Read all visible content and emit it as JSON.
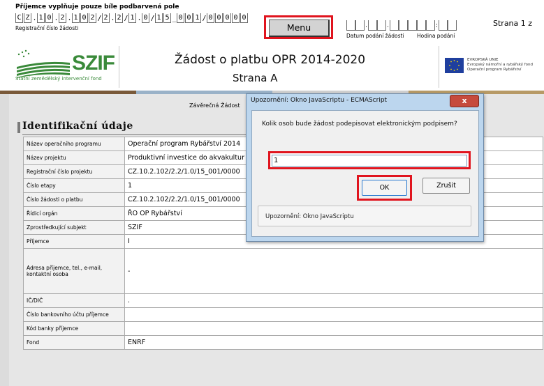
{
  "header": {
    "note": "Příjemce vyplňuje pouze bíle podbarvená pole",
    "registration_cells": [
      "C",
      "Z",
      ".",
      "1",
      "0",
      ".",
      "2",
      ".",
      "1",
      "0",
      "2",
      "/",
      "2",
      ".",
      "2",
      "/",
      "1",
      ".",
      "0",
      "/",
      "1",
      "5",
      "_",
      "0",
      "0",
      "1",
      "/",
      "0",
      "0",
      "0",
      "0",
      "0"
    ],
    "registration_label": "Registrační číslo žádosti",
    "menu_label": "Menu",
    "date_label": "Datum podání žádosti",
    "hour_label": "Hodina podání",
    "page_indicator": "Strana 1 z"
  },
  "titleband": {
    "logo_text": "SZIF",
    "logo_subtitle": "Státní zemědělský intervenční fond",
    "title": "Žádost o platbu OPR 2014-2020",
    "subtitle": "Strana A",
    "eu_lines": [
      "EVROPSKÁ UNIE",
      "Evropský námořní a rybářský fond",
      "Operační program Rybářství"
    ]
  },
  "colors": {
    "accent_red": "#e0141e",
    "bar": [
      "#7a5a3a",
      "#9ab2c8",
      "#cfcfcf",
      "#b79a66"
    ]
  },
  "main": {
    "final_label": "Závěrečná Žádost",
    "section_title": "Identifikační údaje",
    "rows": [
      {
        "label": "Název operačního programu",
        "value": "Operační program Rybářství 2014"
      },
      {
        "label": "Název projektu",
        "value": "Produktivní investice do akvakultur"
      },
      {
        "label": "Registrační číslo projektu",
        "value": "CZ.10.2.102/2.2/1.0/15_001/0000"
      },
      {
        "label": "Číslo etapy",
        "value": "1"
      },
      {
        "label": "Číslo žádosti o platbu",
        "value": "CZ.10.2.102/2.2/1.0/15_001/0000"
      },
      {
        "label": "Řídicí orgán",
        "value": "ŘO OP Rybářství"
      },
      {
        "label": "Zprostředkující subjekt",
        "value": "SZIF"
      },
      {
        "label": "Příjemce",
        "value": "I"
      },
      {
        "label": "Adresa příjemce, tel., e-mail, kontaktní osoba",
        "value": "-"
      },
      {
        "label": "IČ/DIČ",
        "value": "."
      },
      {
        "label": "Číslo bankovního účtu příjemce",
        "value": ""
      },
      {
        "label": "Kód banky příjemce",
        "value": ""
      },
      {
        "label": "Fond",
        "value": "ENRF"
      }
    ]
  },
  "dialog": {
    "title": "Upozornění: Okno JavaScriptu - ECMAScript",
    "close_label": "x",
    "question": "Kolik osob bude žádost podepisovat elektronickým podpisem?",
    "input_value": "1",
    "ok_label": "OK",
    "cancel_label": "Zrušit",
    "status": "Upozornění: Okno JavaScriptu"
  }
}
